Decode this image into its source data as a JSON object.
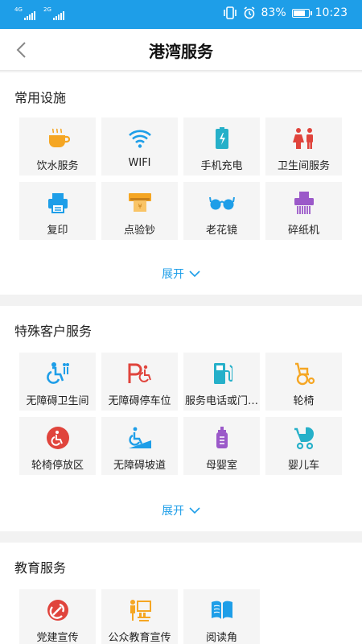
{
  "status": {
    "net1": "4G",
    "net2": "2G",
    "battery_pct": "83%",
    "battery_level": 0.83,
    "time": "10:23"
  },
  "nav": {
    "title": "港湾服务"
  },
  "sections": [
    {
      "title": "常用设施",
      "expand_label": "展开",
      "items": [
        {
          "label": "饮水服务",
          "icon": "cup-icon"
        },
        {
          "label": "WIFI",
          "icon": "wifi-icon"
        },
        {
          "label": "手机充电",
          "icon": "phone-charge-icon"
        },
        {
          "label": "卫生间服务",
          "icon": "restroom-icon"
        },
        {
          "label": "复印",
          "icon": "printer-icon"
        },
        {
          "label": "点验钞",
          "icon": "cash-counter-icon"
        },
        {
          "label": "老花镜",
          "icon": "glasses-icon"
        },
        {
          "label": "碎纸机",
          "icon": "shredder-icon"
        }
      ]
    },
    {
      "title": "特殊客户服务",
      "expand_label": "展开",
      "items": [
        {
          "label": "无障碍卫生间",
          "icon": "accessible-restroom-icon"
        },
        {
          "label": "无障碍停车位",
          "icon": "accessible-parking-icon"
        },
        {
          "label": "服务电话或门…",
          "icon": "service-phone-icon"
        },
        {
          "label": "轮椅",
          "icon": "wheelchair-icon"
        },
        {
          "label": "轮椅停放区",
          "icon": "wheelchair-parking-icon"
        },
        {
          "label": "无障碍坡道",
          "icon": "ramp-icon"
        },
        {
          "label": "母婴室",
          "icon": "baby-bottle-icon"
        },
        {
          "label": "婴儿车",
          "icon": "stroller-icon"
        }
      ]
    },
    {
      "title": "教育服务",
      "items": [
        {
          "label": "党建宣传",
          "icon": "party-emblem-icon"
        },
        {
          "label": "公众教育宣传",
          "icon": "public-education-icon"
        },
        {
          "label": "阅读角",
          "icon": "book-icon"
        }
      ]
    }
  ],
  "colors": {
    "accent": "#1e9ee8",
    "orange": "#f5a623",
    "red": "#e0443c",
    "purple": "#9b59c9"
  }
}
